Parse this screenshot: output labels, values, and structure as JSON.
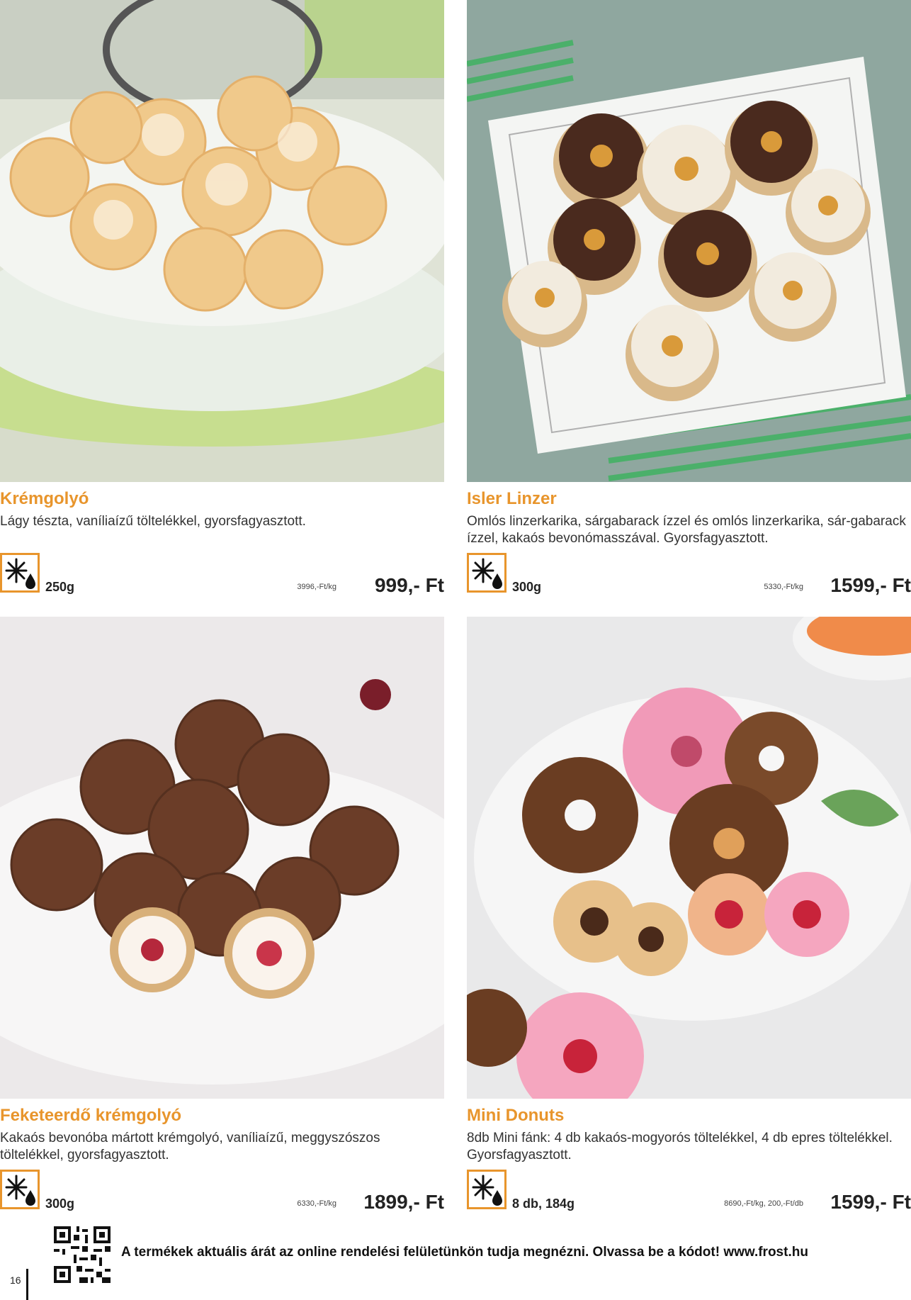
{
  "products": [
    {
      "title": "Krémgolyó",
      "description": "Lágy tészta, vaníliaízű töltelékkel, gyorsfagyasztott.",
      "weight": "250g",
      "unit_price": "3996,-Ft/kg",
      "price": "999,- Ft",
      "icon": "frozen-snowflake-icon"
    },
    {
      "title": "Isler Linzer",
      "description": "Omlós linzerkarika, sárgabarack ízzel és omlós linzerkarika, sár-gabarack ízzel, kakaós bevonómasszával. Gyorsfagyasztott.",
      "weight": "300g",
      "unit_price": "5330,-Ft/kg",
      "price": "1599,- Ft",
      "icon": "frozen-snowflake-icon"
    },
    {
      "title": "Feketeerdő krémgolyó",
      "description": "Kakaós bevonóba mártott krémgolyó, vaníliaízű, meggyszószos töltelékkel, gyorsfagyasztott.",
      "weight": "300g",
      "unit_price": "6330,-Ft/kg",
      "price": "1899,- Ft",
      "icon": "frozen-snowflake-icon"
    },
    {
      "title": "Mini Donuts",
      "description": "8db Mini fánk: 4 db kakaós-mogyorós töltelékkel, 4 db epres töltelékkel. Gyorsfagyasztott.",
      "weight": "8 db, 184g",
      "unit_price": "8690,-Ft/kg, 200,-Ft/db",
      "price": "1599,- Ft",
      "icon": "frozen-snowflake-icon"
    }
  ],
  "footer": {
    "note": "A termékek aktuális árát az online rendelési felületünkön tudja megnézni. Olvassa be a kódot! www.frost.hu",
    "page_number": "16"
  },
  "colors": {
    "accent": "#e8952c",
    "text": "#222222"
  }
}
